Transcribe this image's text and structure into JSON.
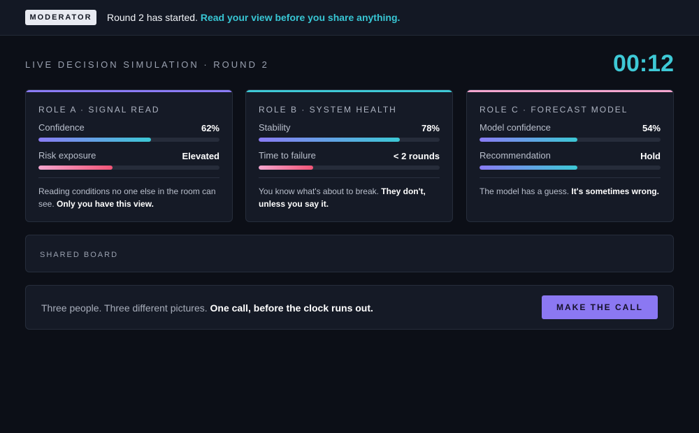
{
  "topbar": {
    "badge": "MODERATOR",
    "message_plain": "Round 2 has started. ",
    "message_accent": "Read your view before you share anything."
  },
  "header": {
    "title": "LIVE DECISION SIMULATION · ROUND 2",
    "timer": "00:12"
  },
  "roles": [
    {
      "title": "ROLE A · SIGNAL READ",
      "accent_color": "#8b7cf6",
      "metrics": [
        {
          "label": "Confidence",
          "value": "62%",
          "fill": 0.62,
          "style": "purple-teal"
        },
        {
          "label": "Risk exposure",
          "value": "Elevated",
          "fill": 0.41,
          "style": "pink"
        }
      ],
      "note_plain": "Reading conditions no one else in the room can see. ",
      "note_bold": "Only you have this view."
    },
    {
      "title": "ROLE B · SYSTEM HEALTH",
      "accent_color": "#3ec9d6",
      "metrics": [
        {
          "label": "Stability",
          "value": "78%",
          "fill": 0.78,
          "style": "purple-teal"
        },
        {
          "label": "Time to failure",
          "value": "< 2 rounds",
          "fill": 0.3,
          "style": "pink"
        }
      ],
      "note_plain": "You know what's about to break. ",
      "note_bold": "They don't, unless you say it."
    },
    {
      "title": "ROLE C · FORECAST MODEL",
      "accent_color": "#f4a6cf",
      "metrics": [
        {
          "label": "Model confidence",
          "value": "54%",
          "fill": 0.54,
          "style": "purple-teal"
        },
        {
          "label": "Recommendation",
          "value": "Hold",
          "fill": 0.54,
          "style": "purple-teal"
        }
      ],
      "note_plain": "The model has a guess. ",
      "note_bold": "It's sometimes wrong."
    }
  ],
  "shared_board": {
    "label": "SHARED BOARD"
  },
  "callbar": {
    "text_plain": "Three people. Three different pictures. ",
    "text_bold": "One call, before the clock runs out.",
    "button_label": "MAKE THE CALL"
  }
}
